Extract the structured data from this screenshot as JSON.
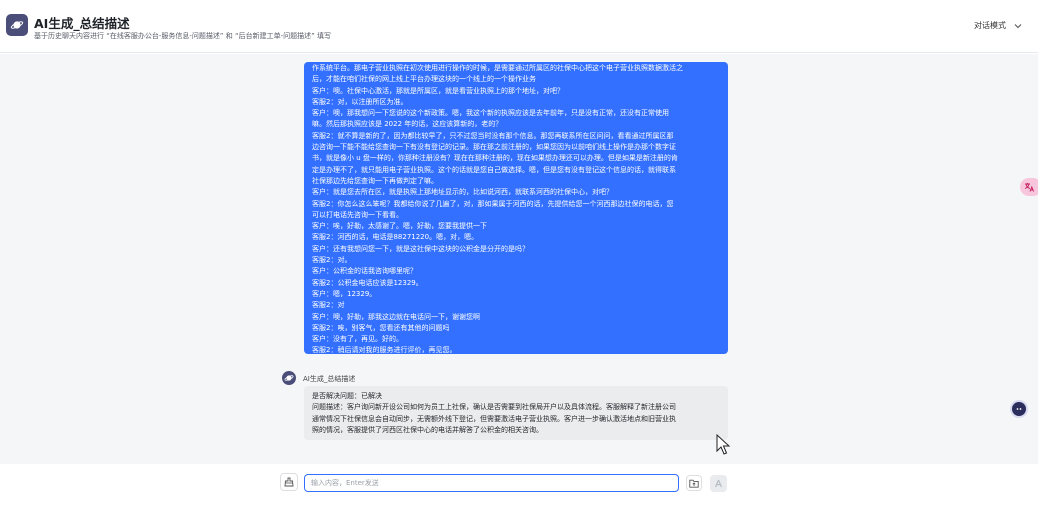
{
  "header": {
    "title": "AI生成_总结描述",
    "subtitle": "基于历史聊天内容进行 “在线客服办公台-服务信息-问题描述” 和 “后台新建工单-问题描述” 填写",
    "mode_label": "对话模式"
  },
  "user_message": {
    "lines": [
      "作系统平台。那电子营业执照在初次使用进行操作的时候，是需要通过所属区的社保中心把这个电子营业执照数据激活之",
      "后，才能在咱们社保的网上线上平台办理这块的一个线上的一个操作业务",
      "客户：噢。社保中心激活，那就是所属区，就是看营业执照上的那个地址，对吧？",
      "客服2：对，以注册所区为准。",
      "客户：噢，那我想问一下您说的这个新政策。嗯，我这个新的执照应该是去年前年，只是没有正常，还没有正常使用",
      "嘛。然后那执照应该是 2022 年的话，这应该算新的，老的？",
      "客服2：就不算是新的了，因为都比较早了，只不过您当时没有那个信息。那您再联系所在区问问，看看通过所属区那",
      "边咨询一下能不能给您查询一下有没有登记的记录。那在那之前注册的，如果您因为以前咱们线上操作是办那个数字证",
      "书，就是像小 u 盘一样的，你那种注册没有？现在在那种注册的，现在如果想办理还可以办理。但是如果是新注册的肯",
      "定是办理不了，就只能用电子营业执照。这个的话就是您自己做选择。嗯，但是您有没有登记这个信息的话，就得联系",
      "社保那边先给您查询一下再做判定了嘛。",
      "客户：就是您去所在区，就是执照上那地址显示的，比如说河西，就联系河西的社保中心，对吧？",
      "客服2：你怎么这么笨呢？我都给你说了几遍了，对，那如果属于河西的话，先提供给您一个河西那边社保的电话，您",
      "可以打电话先咨询一下看看。",
      "客户：唉，好勒，太感谢了。嗯，好勒，您要我提供一下",
      "客服2：河西的话，电话是88271220。嗯，对，嗯。",
      "客户：还有我想问您一下，就是这社保中这块的公积金是分开的是吗？",
      "客服2：对。",
      "客户：公积金的话我咨询哪里呢？",
      "客服2：公积金电话应该是12329。",
      "客户：嗯，12329。",
      "客服2：对",
      "客户：噢，好勒，那我这边就在电话问一下，谢谢您啊",
      "客服2：唉，别客气，您看还有其他的问题吗",
      "客户：没有了，再见。好的。",
      "客服2：稍后请对我的服务进行评价，再见您。"
    ]
  },
  "ai_message": {
    "name": "AI生成_总结描述",
    "lines": [
      "是否解决问题：已解决",
      "问题描述：客户询问新开设公司如何为员工上社保，确认是否需要到社保局开户以及具体流程。客服解释了新注册公司",
      "通常情况下社保信息会自动同步，无需额外线下登记，但需要激活电子营业执照。客户进一步确认激活地点和旧营业执",
      "照的情况，客服提供了河西区社保中心的电话并解答了公积金的相关咨询。"
    ]
  },
  "input": {
    "placeholder": "输入内容，Enter发送",
    "value": ""
  },
  "icons": {
    "logo": "planet-icon",
    "mode_chevron": "chevron-down-icon",
    "clear": "broom-icon",
    "file": "folder-upload-icon",
    "send": "send-icon",
    "translate": "translate-icon",
    "assistant": "assistant-icon",
    "cursor": "mouse-cursor-icon"
  },
  "colors": {
    "accent": "#3370ff",
    "logo_bg": "#4b4e79",
    "ai_bubble": "#ebeced",
    "page_bg": "#f5f6f7"
  }
}
